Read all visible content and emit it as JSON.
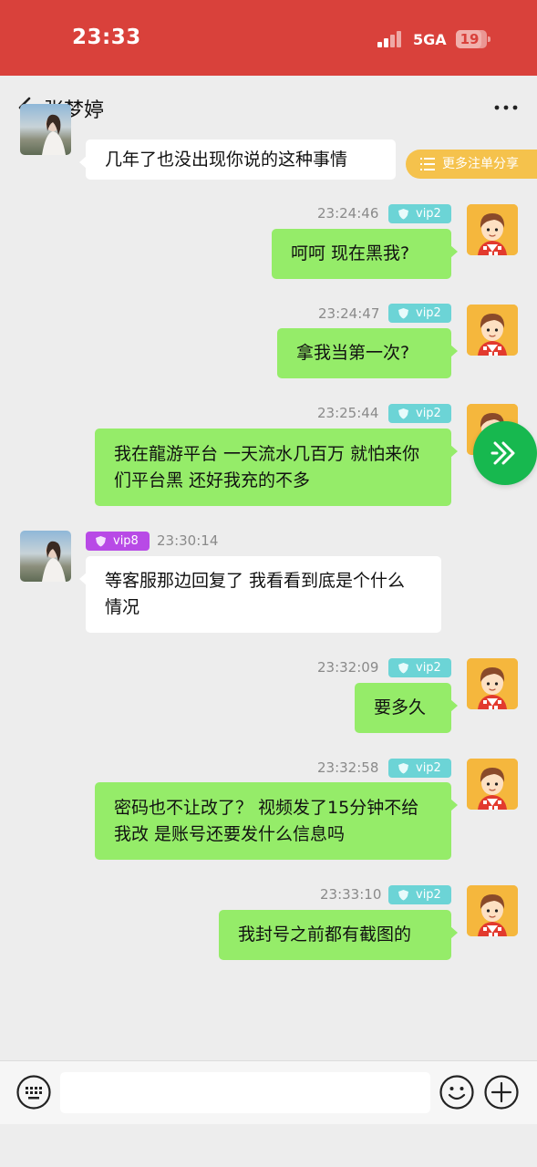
{
  "status_bar": {
    "time": "23:33",
    "network": "5GA",
    "battery": "19"
  },
  "header": {
    "contact_name": "张梦婷"
  },
  "share_button": {
    "label": "更多注单分享"
  },
  "messages": [
    {
      "side": "left",
      "text": "几年了也没出现你说的这种事情"
    },
    {
      "side": "right",
      "time": "23:24:46",
      "badge": "vip2",
      "text": "呵呵 现在黑我?"
    },
    {
      "side": "right",
      "time": "23:24:47",
      "badge": "vip2",
      "text": "拿我当第一次?"
    },
    {
      "side": "right",
      "time": "23:25:44",
      "badge": "vip2",
      "text": "我在龍游平台 一天流水几百万 就怕来你们平台黑 还好我充的不多"
    },
    {
      "side": "left",
      "time": "23:30:14",
      "badge": "vip8",
      "text": "等客服那边回复了 我看看到底是个什么情况"
    },
    {
      "side": "right",
      "time": "23:32:09",
      "badge": "vip2",
      "text": "要多久"
    },
    {
      "side": "right",
      "time": "23:32:58",
      "badge": "vip2",
      "text": "密码也不让改了？ 视频发了15分钟不给我改 是账号还要发什么信息吗"
    },
    {
      "side": "right",
      "time": "23:33:10",
      "badge": "vip2",
      "text": "我封号之前都有截图的"
    }
  ],
  "input": {
    "value": "",
    "placeholder": ""
  },
  "colors": {
    "status_bar": "#d9413b",
    "bubble_self": "#95ec69",
    "bubble_other": "#ffffff",
    "vip2_badge": "#6cd4d6",
    "vip8_badge": "#b84ae6",
    "share_pill": "#f5c24c",
    "fab": "#17b84f"
  },
  "icons": {
    "back": "chevron-left-icon",
    "more": "more-dots-icon",
    "share": "list-icon",
    "badge": "shield-icon",
    "fab": "double-chevron-right-icon",
    "keyboard": "keyboard-icon",
    "emoji": "smile-icon",
    "plus": "plus-icon"
  }
}
